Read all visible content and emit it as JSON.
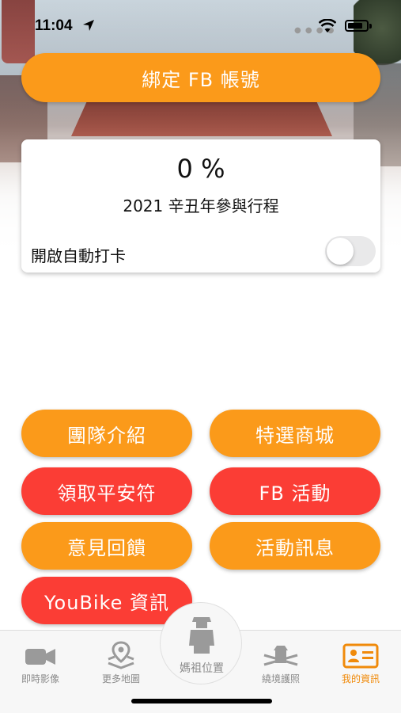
{
  "status_bar": {
    "time": "11:04"
  },
  "header": {
    "fb_bind_label": "綁定 FB 帳號"
  },
  "progress_card": {
    "percent_text": "0 %",
    "progress": 0,
    "subtitle": "2021 辛丑年參與行程",
    "auto_checkin_label": "開啟自動打卡",
    "auto_checkin_on": false
  },
  "actions": {
    "team_intro": "團隊介紹",
    "shop": "特選商城",
    "amulet": "領取平安符",
    "fb_event": "FB 活動",
    "feedback": "意見回饋",
    "event_news": "活動訊息",
    "youbike": "YouBike 資訊"
  },
  "tabbar": {
    "live": "即時影像",
    "maps": "更多地圖",
    "mazu": "媽祖位置",
    "permit": "繞境護照",
    "profile": "我的資訊"
  },
  "colors": {
    "orange": "#fb9a1a",
    "red": "#fb3d35",
    "active_tab": "#f08a0a",
    "inactive_tab": "#8a8a8a"
  }
}
